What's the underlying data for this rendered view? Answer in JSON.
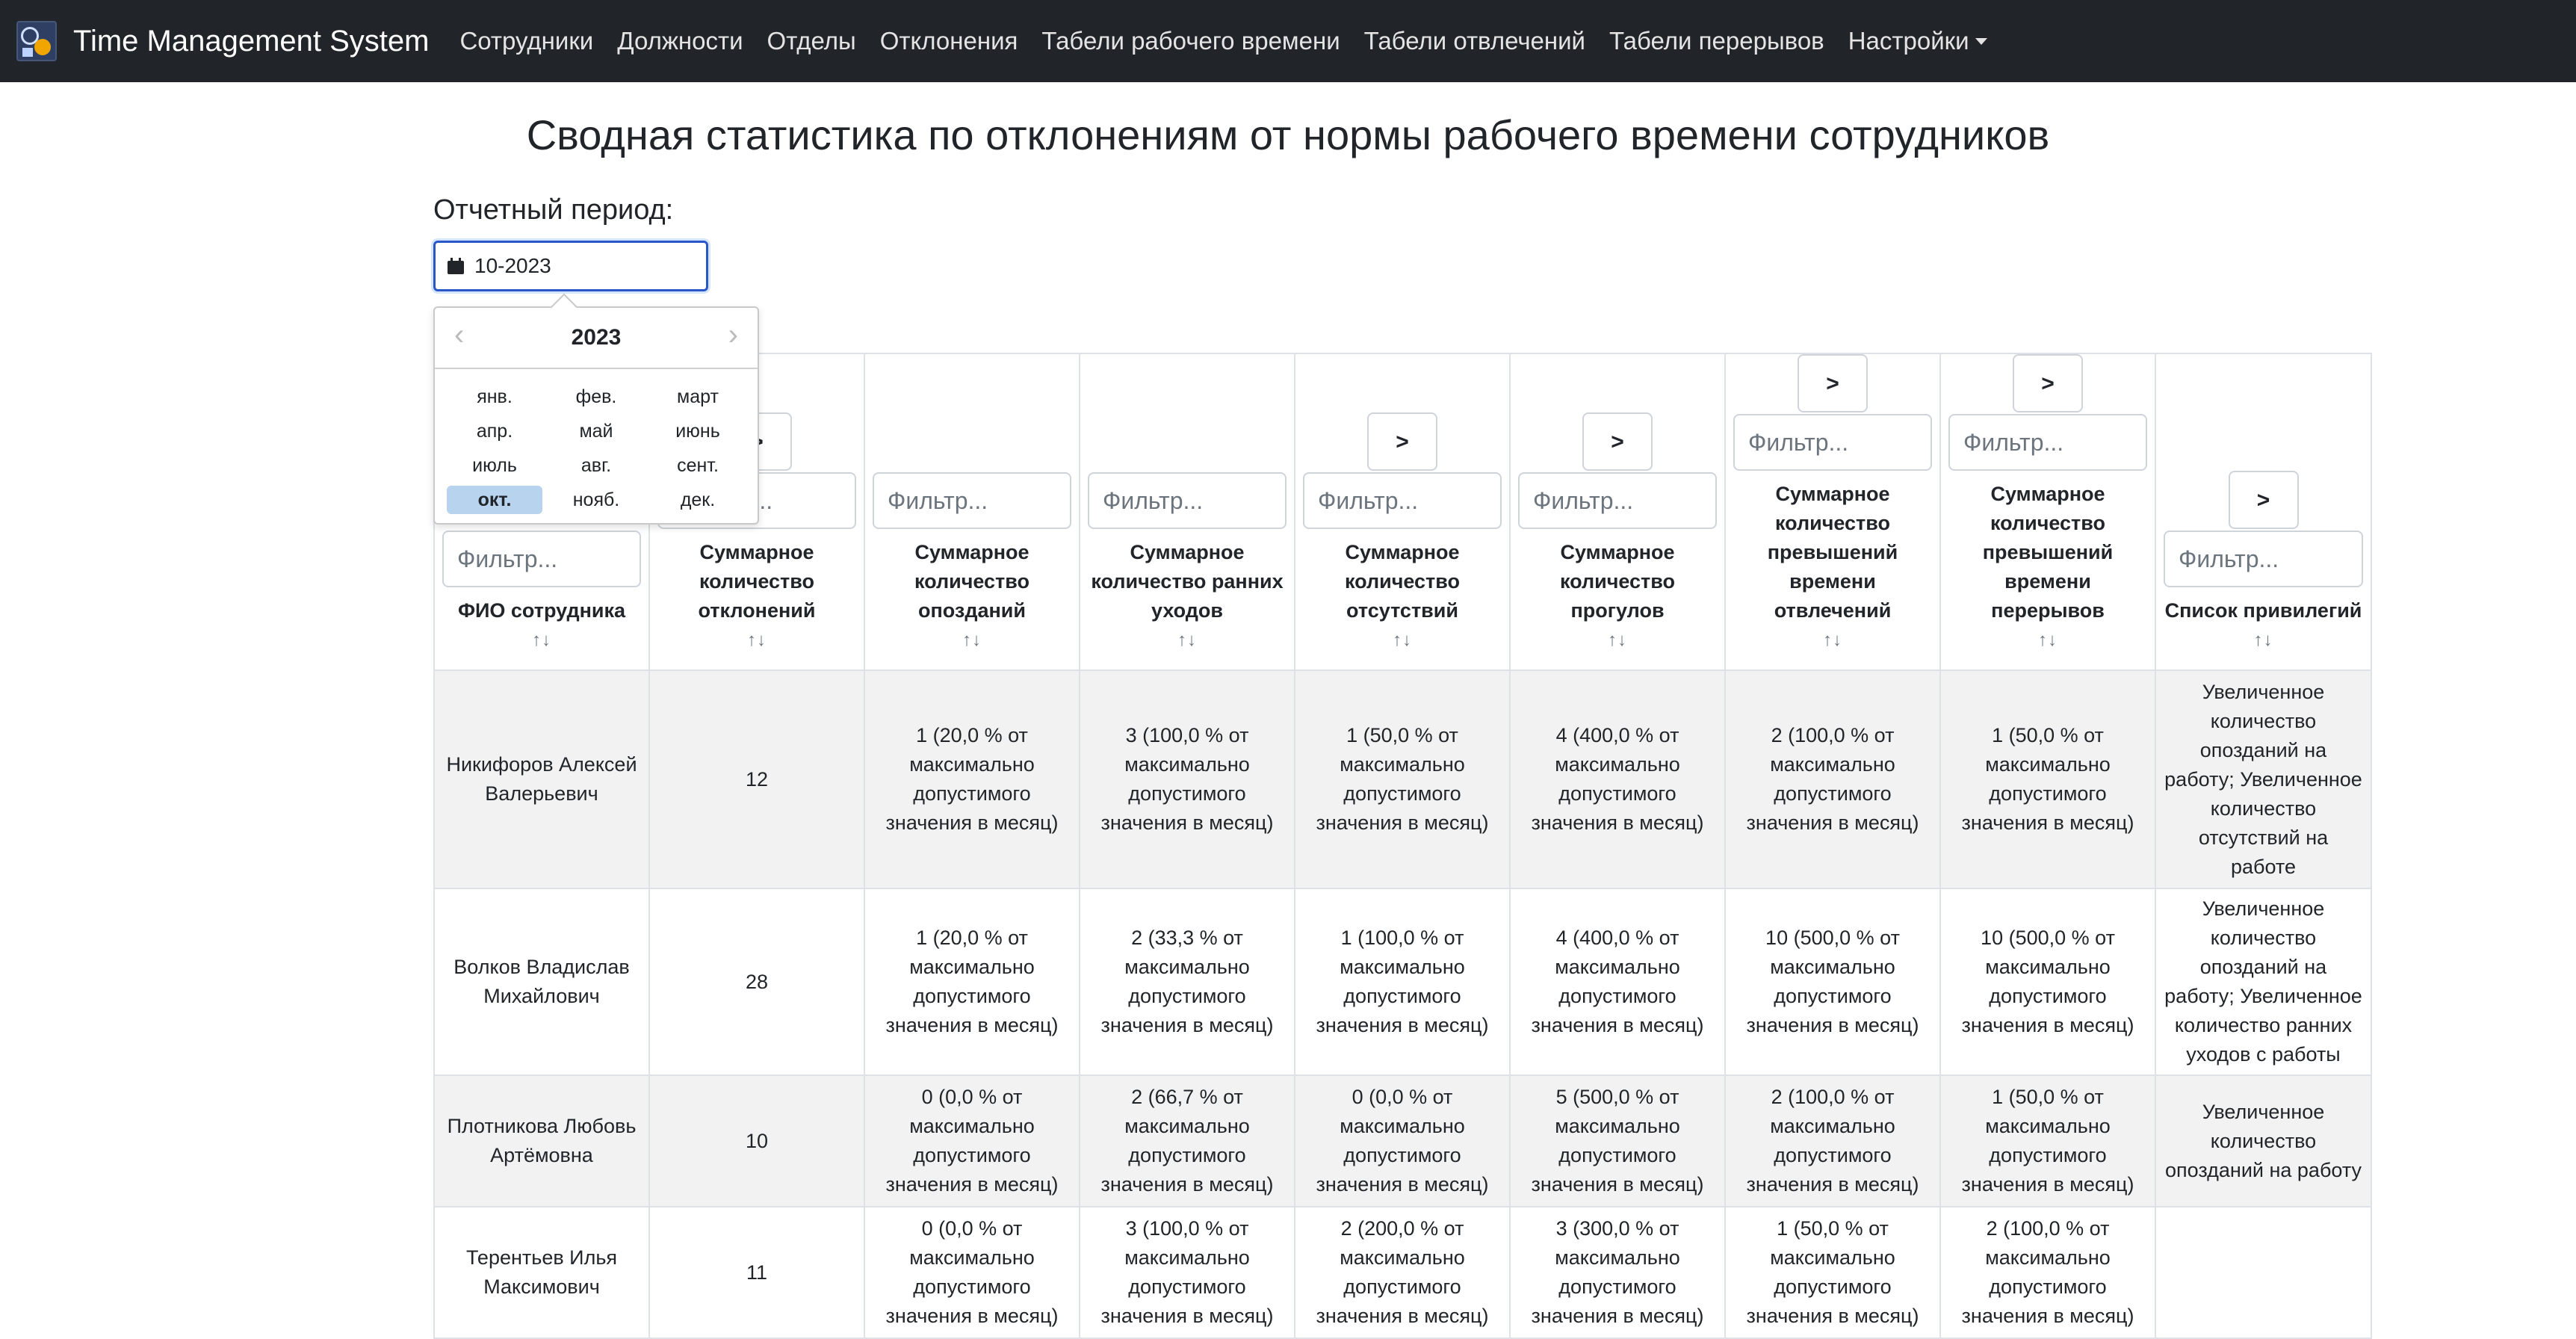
{
  "navbar": {
    "brand": "Time Management System",
    "items": [
      {
        "label": "Сотрудники"
      },
      {
        "label": "Должности"
      },
      {
        "label": "Отделы"
      },
      {
        "label": "Отклонения"
      },
      {
        "label": "Табели рабочего времени"
      },
      {
        "label": "Табели отвлечений"
      },
      {
        "label": "Табели перерывов"
      },
      {
        "label": "Настройки"
      }
    ]
  },
  "page_title": "Сводная статистика по отклонениям от нормы рабочего времени сотрудников",
  "period": {
    "label": "Отчетный период:",
    "value": "10-2023"
  },
  "picker": {
    "year": "2023",
    "prev": "‹",
    "next": "›",
    "months": [
      "янв.",
      "фев.",
      "март",
      "апр.",
      "май",
      "июнь",
      "июль",
      "авг.",
      "сент.",
      "окт.",
      "нояб.",
      "дек."
    ],
    "selected": "окт."
  },
  "table": {
    "filter_placeholder": "Фильтр...",
    "compare_symbol": ">",
    "sort_symbol": "↑↓",
    "headers": [
      "ФИО сотрудника",
      "Суммарное количество отклонений",
      "Суммарное количество опозданий",
      "Суммарное количество ранних уходов",
      "Суммарное количество отсутствий",
      "Суммарное количество прогулов",
      "Суммарное количество превышений времени отвлечений",
      "Суммарное количество превышений времени перерывов",
      "Список привилегий"
    ],
    "rows": [
      {
        "name": "Никифоров Алексей Валерьевич",
        "total": "12",
        "late": "1 (20,0 % от максимально допустимого значения в месяц)",
        "early": "3 (100,0 % от максимально допустимого значения в месяц)",
        "absent": "1 (50,0 % от максимально допустимого значения в месяц)",
        "truancy": "4 (400,0 % от максимально допустимого значения в месяц)",
        "distraction": "2 (100,0 % от максимально допустимого значения в месяц)",
        "breaks": "1 (50,0 % от максимально допустимого значения в месяц)",
        "privileges": "Увеличенное количество опозданий на работу; Увеличенное количество отсутствий на работе"
      },
      {
        "name": "Волков Владислав Михайлович",
        "total": "28",
        "late": "1 (20,0 % от максимально допустимого значения в месяц)",
        "early": "2 (33,3 % от максимально допустимого значения в месяц)",
        "absent": "1 (100,0 % от максимально допустимого значения в месяц)",
        "truancy": "4 (400,0 % от максимально допустимого значения в месяц)",
        "distraction": "10 (500,0 % от максимально допустимого значения в месяц)",
        "breaks": "10 (500,0 % от максимально допустимого значения в месяц)",
        "privileges": "Увеличенное количество опозданий на работу; Увеличенное количество ранних уходов с работы"
      },
      {
        "name": "Плотникова Любовь Артёмовна",
        "total": "10",
        "late": "0 (0,0 % от максимально допустимого значения в месяц)",
        "early": "2 (66,7 % от максимально допустимого значения в месяц)",
        "absent": "0 (0,0 % от максимально допустимого значения в месяц)",
        "truancy": "5 (500,0 % от максимально допустимого значения в месяц)",
        "distraction": "2 (100,0 % от максимально допустимого значения в месяц)",
        "breaks": "1 (50,0 % от максимально допустимого значения в месяц)",
        "privileges": "Увеличенное количество опозданий на работу"
      },
      {
        "name": "Терентьев Илья Максимович",
        "total": "11",
        "late": "0 (0,0 % от максимально допустимого значения в месяц)",
        "early": "3 (100,0 % от максимально допустимого значения в месяц)",
        "absent": "2 (200,0 % от максимально допустимого значения в месяц)",
        "truancy": "3 (300,0 % от максимально допустимого значения в месяц)",
        "distraction": "1 (50,0 % от максимально допустимого значения в месяц)",
        "breaks": "2 (100,0 % от максимально допустимого значения в месяц)",
        "privileges": ""
      }
    ]
  }
}
